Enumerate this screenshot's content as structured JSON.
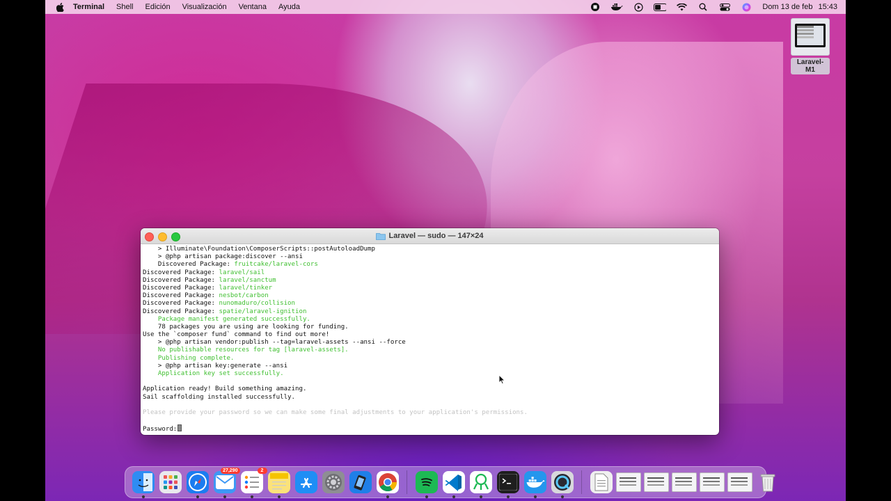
{
  "menubar": {
    "app": "Terminal",
    "items": [
      "Shell",
      "Edición",
      "Visualización",
      "Ventana",
      "Ayuda"
    ],
    "date": "Dom 13 de feb",
    "time": "15:43"
  },
  "desktop": {
    "icon_label": "Laravel-M1"
  },
  "window": {
    "title": "Laravel — sudo — 147×24"
  },
  "terminal": {
    "lines": [
      {
        "t": "    > Illuminate\\Foundation\\ComposerScripts::postAutoloadDump",
        "c": ""
      },
      {
        "t": "    > @php artisan package:discover --ansi",
        "c": ""
      },
      {
        "t": "    Discovered Package: ",
        "c": "",
        "g": "fruitcake/laravel-cors"
      },
      {
        "t": "Discovered Package: ",
        "c": "",
        "g": "laravel/sail"
      },
      {
        "t": "Discovered Package: ",
        "c": "",
        "g": "laravel/sanctum"
      },
      {
        "t": "Discovered Package: ",
        "c": "",
        "g": "laravel/tinker"
      },
      {
        "t": "Discovered Package: ",
        "c": "",
        "g": "nesbot/carbon"
      },
      {
        "t": "Discovered Package: ",
        "c": "",
        "g": "nunomaduro/collision"
      },
      {
        "t": "Discovered Package: ",
        "c": "",
        "g": "spatie/laravel-ignition"
      },
      {
        "t": "    Package manifest generated successfully.",
        "c": "g"
      },
      {
        "t": "    78 packages you are using are looking for funding.",
        "c": ""
      },
      {
        "t": "Use the `composer fund` command to find out more!",
        "c": ""
      },
      {
        "t": "    > @php artisan vendor:publish --tag=laravel-assets --ansi --force",
        "c": ""
      },
      {
        "t": "    No publishable resources for tag [laravel-assets].",
        "c": "g"
      },
      {
        "t": "    Publishing complete.",
        "c": "g"
      },
      {
        "t": "    > @php artisan key:generate --ansi",
        "c": ""
      },
      {
        "t": "    Application key set successfully.",
        "c": "g"
      },
      {
        "t": "",
        "c": ""
      },
      {
        "t": "Application ready! Build something amazing.",
        "c": ""
      },
      {
        "t": "Sail scaffolding installed successfully.",
        "c": ""
      },
      {
        "t": "",
        "c": ""
      },
      {
        "t": "Please provide your password so we can make some final adjustments to your application's permissions.",
        "c": "dim"
      },
      {
        "t": "",
        "c": ""
      },
      {
        "t": "Password:",
        "c": "",
        "cursor": true
      }
    ]
  },
  "dock": {
    "apps": [
      {
        "name": "finder-icon",
        "color": "#2f8cf3",
        "running": true
      },
      {
        "name": "launchpad-icon",
        "color": "#e9e9ee",
        "running": false
      },
      {
        "name": "safari-icon",
        "color": "#1c7cf0",
        "running": true
      },
      {
        "name": "mail-icon",
        "color": "#3e98f5",
        "running": true,
        "badge": "27,290"
      },
      {
        "name": "reminders-icon",
        "color": "#ffffff",
        "running": true,
        "badge": "2"
      },
      {
        "name": "notes-icon",
        "color": "#fbe27a",
        "running": true
      },
      {
        "name": "app-store-icon",
        "color": "#1f8ef5",
        "running": false
      },
      {
        "name": "system-preferences-icon",
        "color": "#8e8e93",
        "running": false
      },
      {
        "name": "xcode-simulator-icon",
        "color": "#1f7fe8",
        "running": false
      },
      {
        "name": "chrome-icon",
        "color": "#ffffff",
        "running": true
      },
      {
        "name": "spotify-icon",
        "color": "#1db954",
        "running": true
      },
      {
        "name": "vscode-icon",
        "color": "#ffffff",
        "running": true
      },
      {
        "name": "phpstorm-icon",
        "color": "#ffffff",
        "running": true
      },
      {
        "name": "terminal-icon",
        "color": "#1e1e1e",
        "running": true
      },
      {
        "name": "docker-icon",
        "color": "#2496ed",
        "running": true
      },
      {
        "name": "quicktime-icon",
        "color": "#d8d8dc",
        "running": true
      }
    ]
  }
}
